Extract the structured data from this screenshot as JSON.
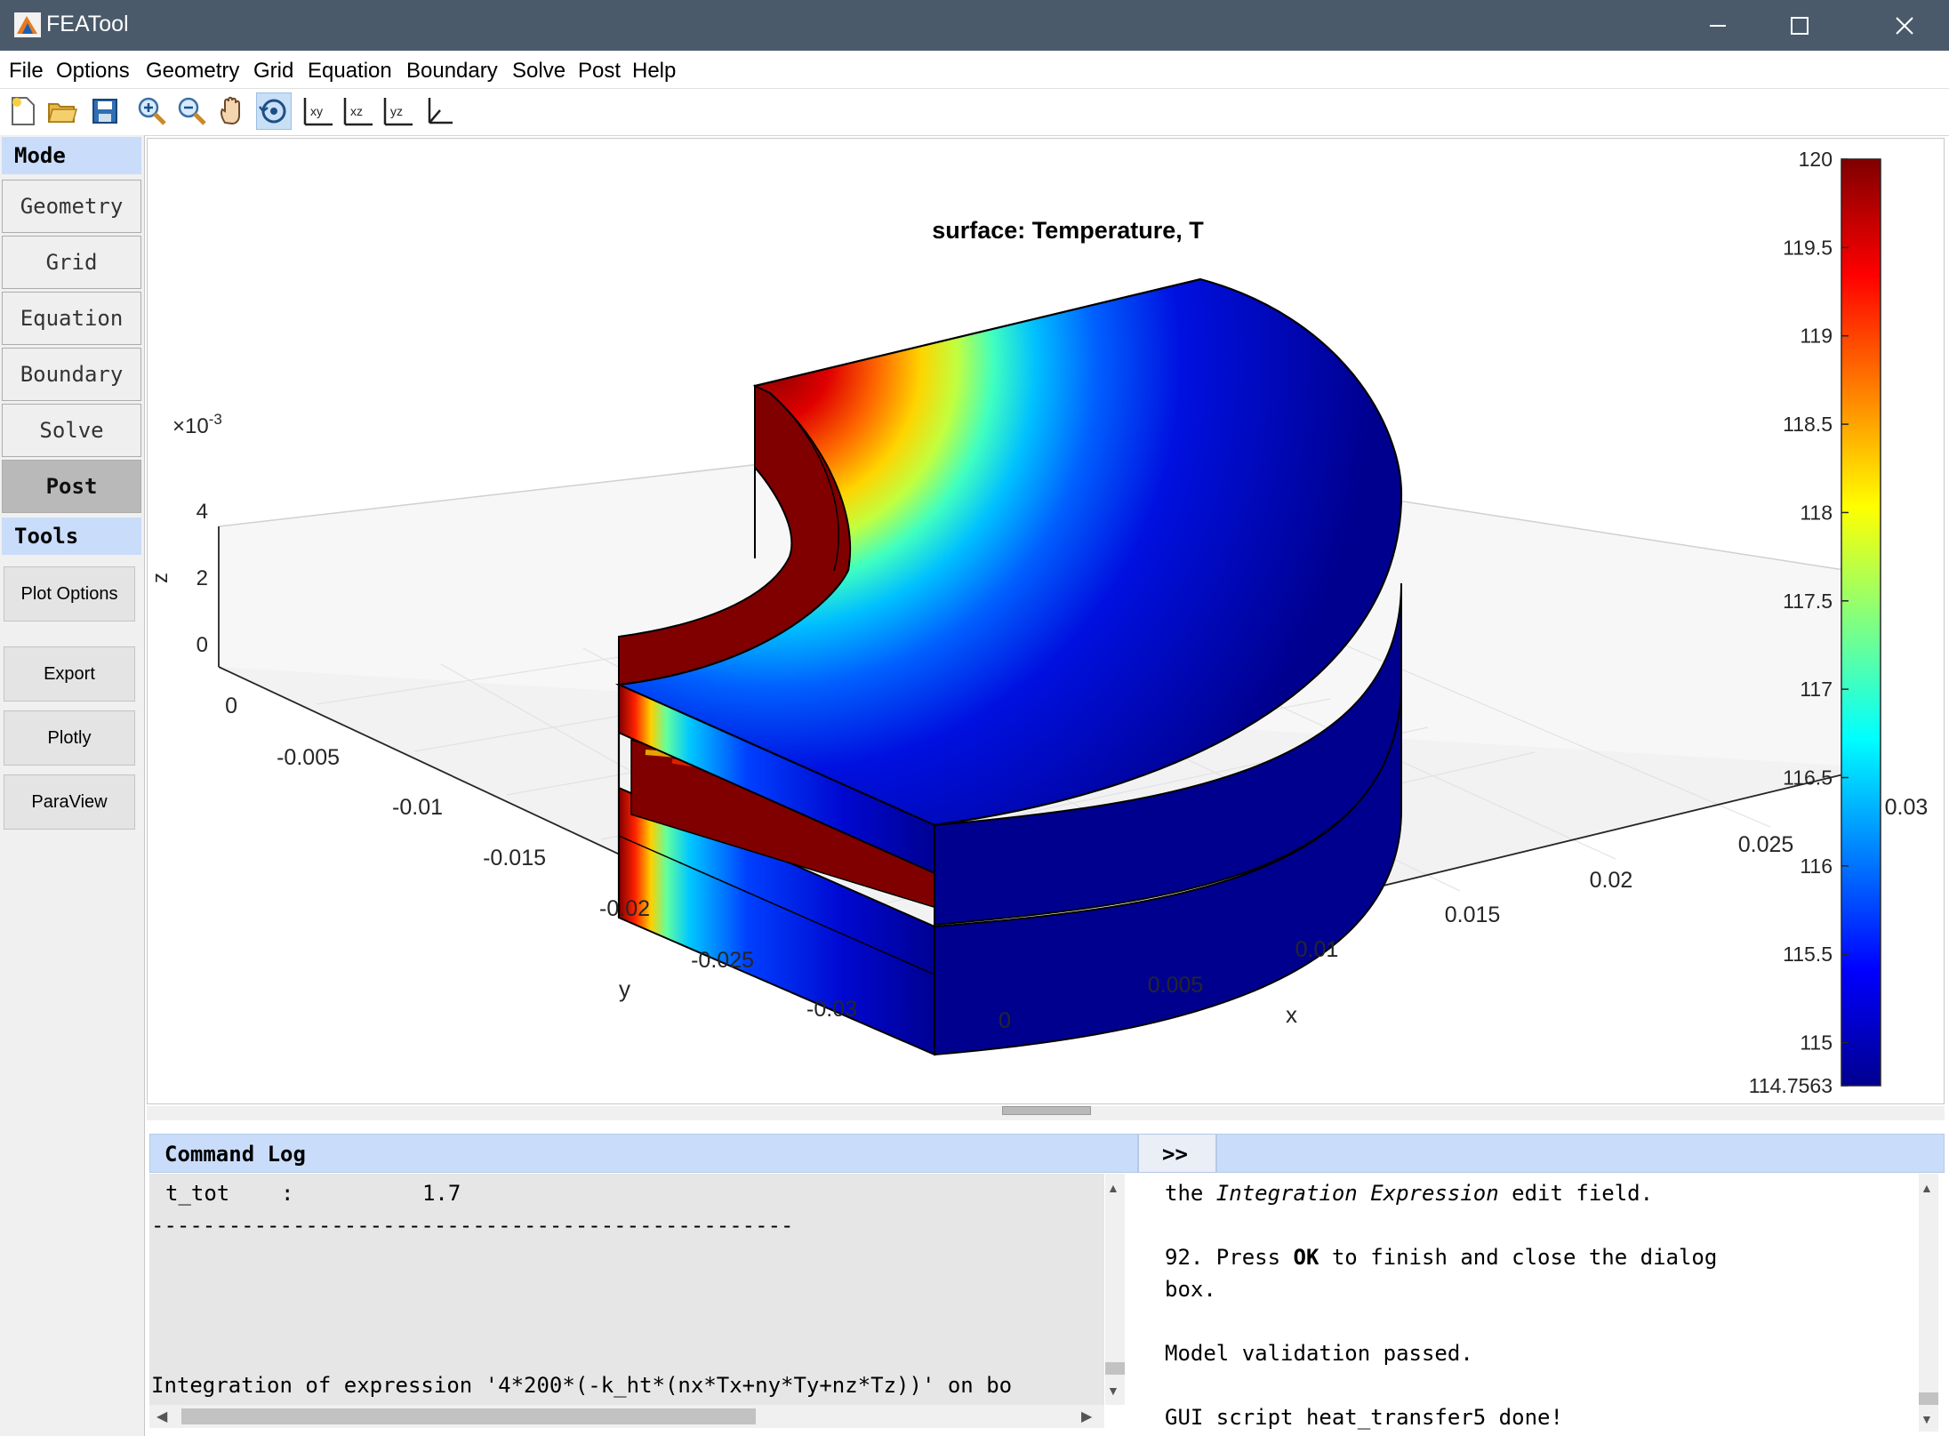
{
  "window": {
    "title": "FEATool",
    "controls": [
      "minimize",
      "maximize",
      "close"
    ]
  },
  "menu": [
    "File",
    "Options",
    "Geometry",
    "Grid",
    "Equation",
    "Boundary",
    "Solve",
    "Post",
    "Help"
  ],
  "toolbar": [
    "new-file-icon",
    "open-folder-icon",
    "save-icon",
    "zoom-in-icon",
    "zoom-out-icon",
    "pan-hand-icon",
    "rotate-3d-icon",
    "view-xy-icon",
    "view-xz-icon",
    "view-yz-icon",
    "view-3d-axes-icon"
  ],
  "sidebar": {
    "mode_header": "Mode",
    "modes": [
      "Geometry",
      "Grid",
      "Equation",
      "Boundary",
      "Solve",
      "Post"
    ],
    "active_mode": "Post",
    "tools_header": "Tools",
    "tools": [
      "Plot Options",
      "Export",
      "Plotly",
      "ParaView"
    ]
  },
  "plot": {
    "title": "surface: Temperature, T",
    "z_exponent_base": "×10",
    "z_exponent": "-3",
    "xlabel": "x",
    "ylabel": "y",
    "zlabel": "z",
    "x_ticks": [
      "0",
      "0.005",
      "0.01",
      "0.015",
      "0.02",
      "0.025",
      "0.03"
    ],
    "y_ticks": [
      "0",
      "-0.005",
      "-0.01",
      "-0.015",
      "-0.02",
      "-0.025",
      "-0.03"
    ],
    "z_ticks": [
      "0",
      "2",
      "4"
    ],
    "colorbar_ticks": [
      "120",
      "119.5",
      "119",
      "118.5",
      "118",
      "117.5",
      "117",
      "116.5",
      "116",
      "115.5",
      "115",
      "114.7563"
    ],
    "colorbar_min": 114.7563,
    "colorbar_max": 120,
    "colormap": "jet",
    "colors": {
      "hot": "#800000",
      "cold": "#00008f"
    }
  },
  "command_log": {
    "header": "Command Log",
    "lines": [
      "t_tot    :          1.7",
      "--------------------------------------------------",
      "",
      "",
      "",
      "Integration of expression '4*200*(-k_ht*(nx*Tx+ny*Ty+nz*Tz))' on bo"
    ]
  },
  "help_panel": {
    "toggle_label": ">>",
    "p1_pre": "the ",
    "p1_italic": "Integration Expression",
    "p1_post": " edit field.",
    "p2_pre": "92. Press ",
    "p2_bold": "OK",
    "p2_post": " to finish and close the dialog",
    "p2_line2": "box.",
    "p3": "Model validation passed.",
    "p4": "GUI script heat_transfer5 done!"
  }
}
